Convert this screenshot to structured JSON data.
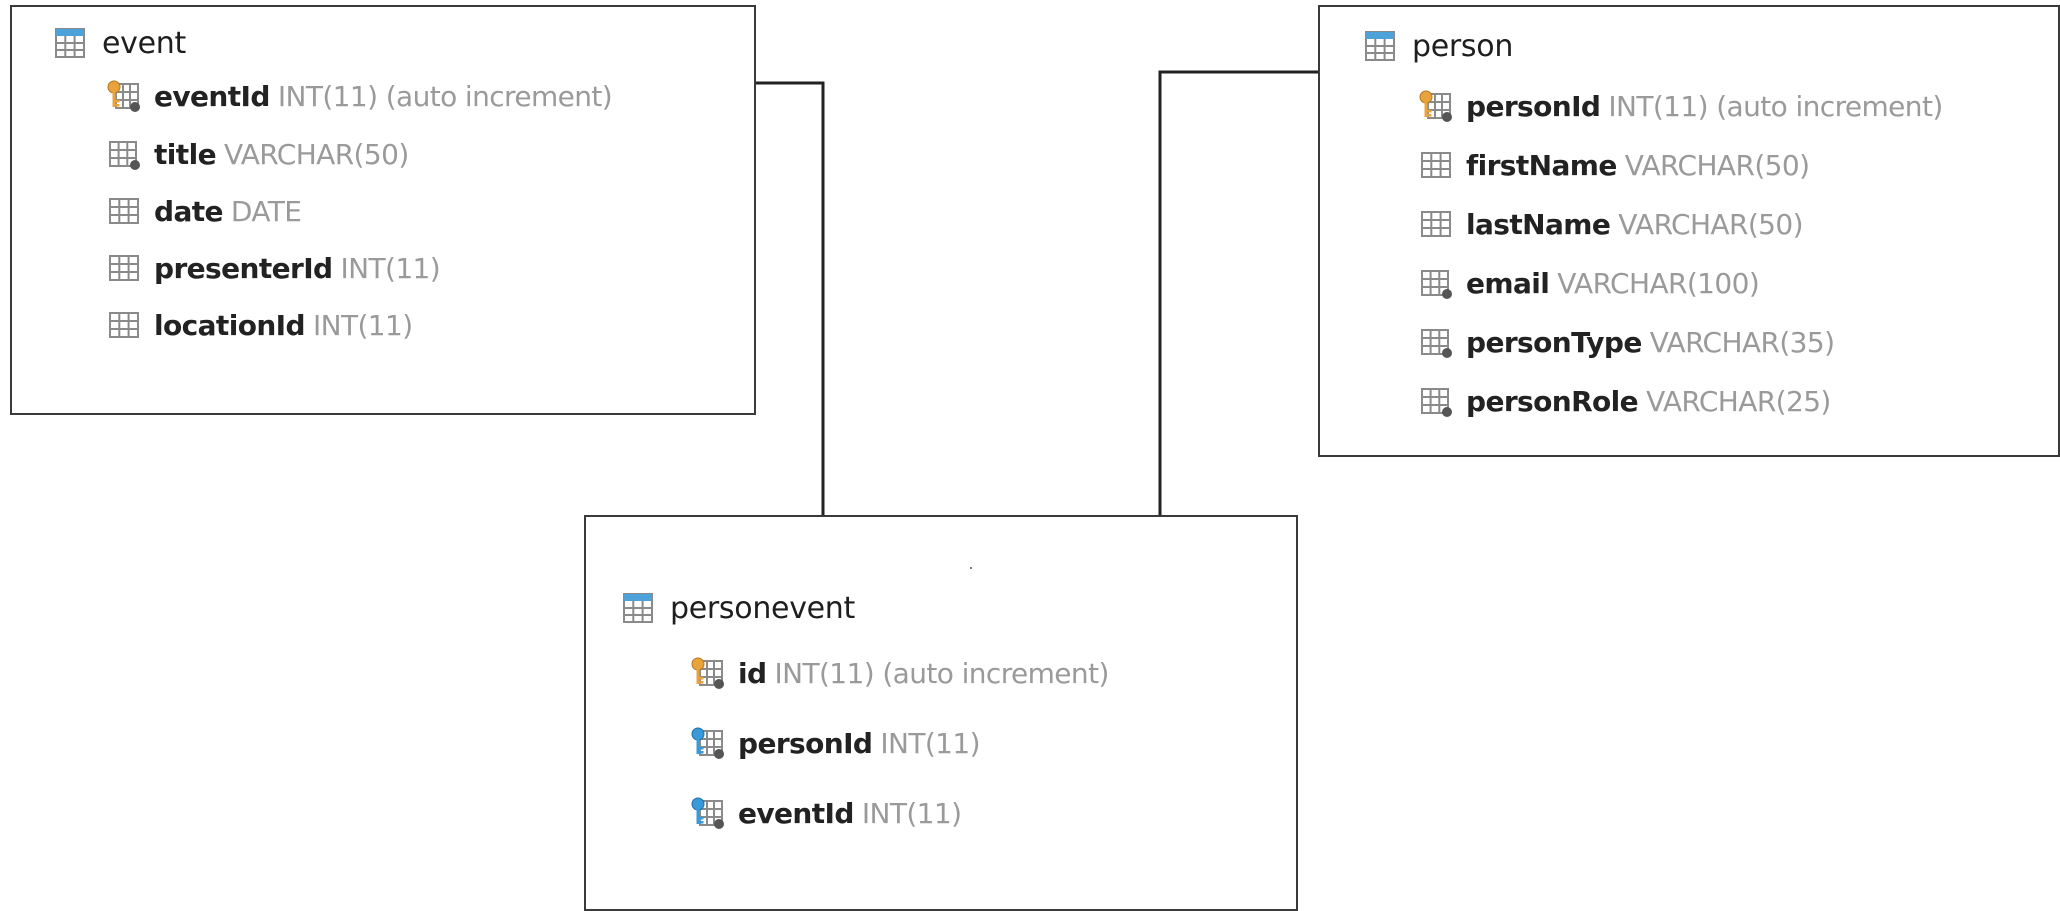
{
  "tables": [
    {
      "id": "event",
      "name": "event",
      "fields": [
        {
          "name": "eventId",
          "type": "INT(11) (auto increment)",
          "icon": "primary-key-icon"
        },
        {
          "name": "title",
          "type": "VARCHAR(50)",
          "icon": "column-indexed-icon"
        },
        {
          "name": "date",
          "type": "DATE",
          "icon": "column-icon"
        },
        {
          "name": "presenterId",
          "type": "INT(11)",
          "icon": "column-icon"
        },
        {
          "name": "locationId",
          "type": "INT(11)",
          "icon": "column-icon"
        }
      ]
    },
    {
      "id": "person",
      "name": "person",
      "fields": [
        {
          "name": "personId",
          "type": "INT(11) (auto increment)",
          "icon": "primary-key-icon"
        },
        {
          "name": "firstName",
          "type": "VARCHAR(50)",
          "icon": "column-icon"
        },
        {
          "name": "lastName",
          "type": "VARCHAR(50)",
          "icon": "column-icon"
        },
        {
          "name": "email",
          "type": "VARCHAR(100)",
          "icon": "column-indexed-icon"
        },
        {
          "name": "personType",
          "type": "VARCHAR(35)",
          "icon": "column-indexed-icon"
        },
        {
          "name": "personRole",
          "type": "VARCHAR(25)",
          "icon": "column-indexed-icon"
        }
      ]
    },
    {
      "id": "personevent",
      "name": "personevent",
      "fields": [
        {
          "name": "id",
          "type": "INT(11) (auto increment)",
          "icon": "primary-key-icon"
        },
        {
          "name": "personId",
          "type": "INT(11)",
          "icon": "foreign-key-icon"
        },
        {
          "name": "eventId",
          "type": "INT(11)",
          "icon": "foreign-key-icon"
        }
      ]
    }
  ],
  "relationships": [
    {
      "from": "personevent",
      "to": "event"
    },
    {
      "from": "personevent",
      "to": "person"
    }
  ],
  "icon_names": {
    "table": "table-icon"
  }
}
